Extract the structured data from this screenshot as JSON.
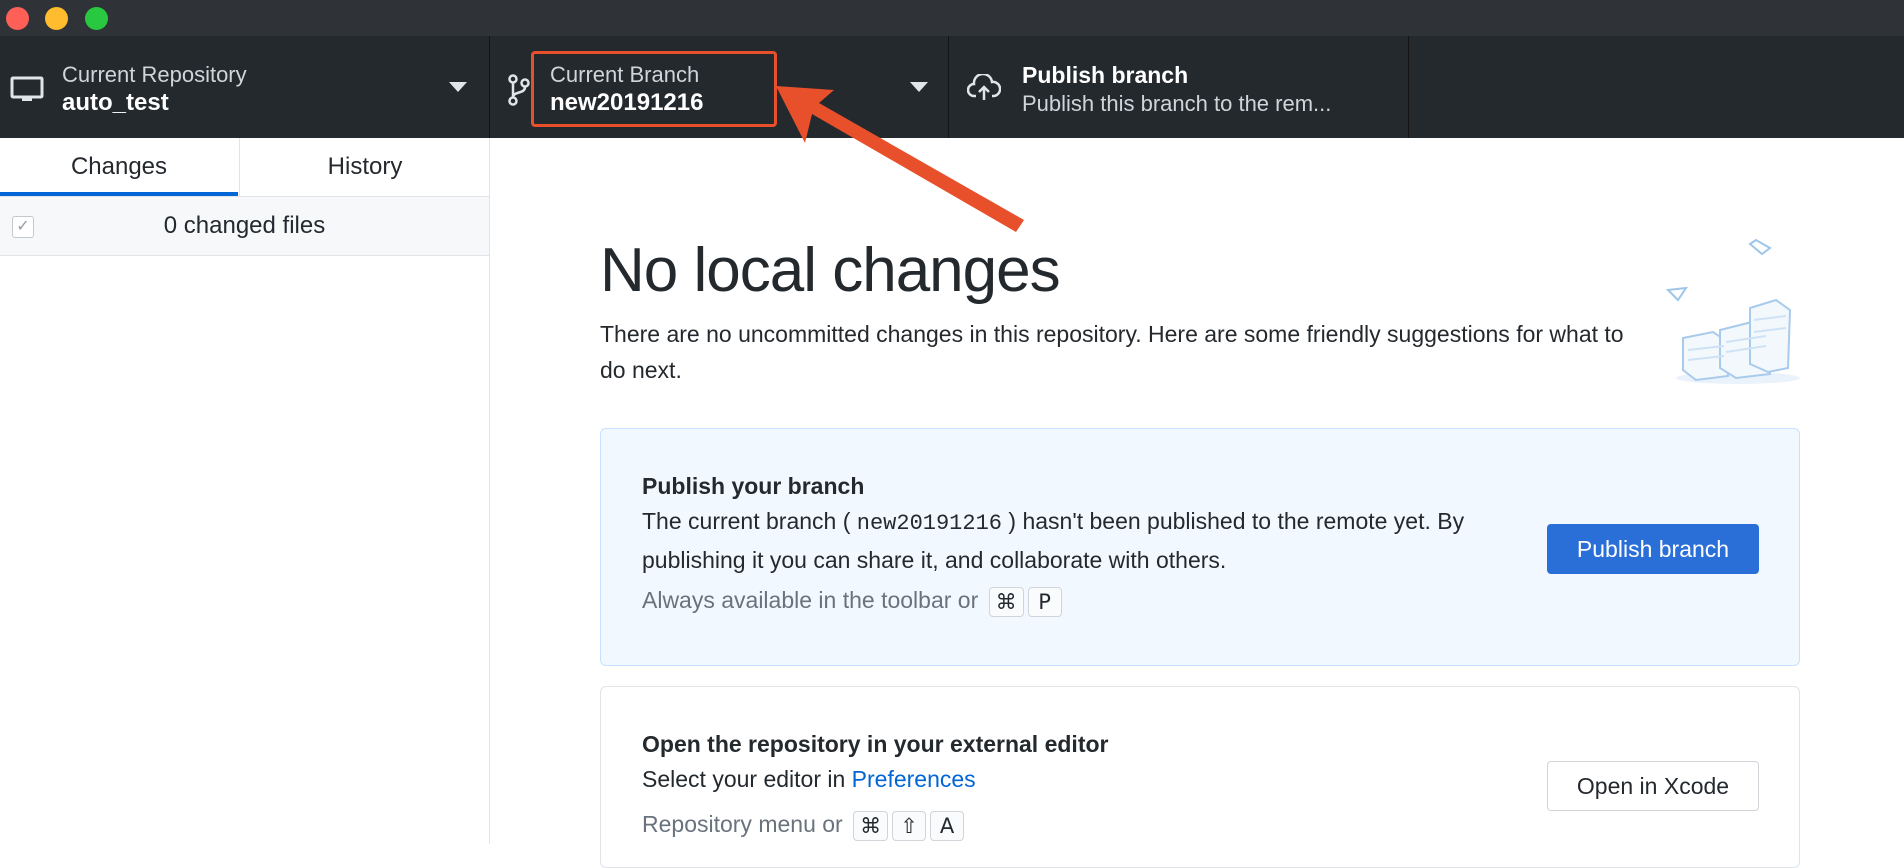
{
  "toolbar": {
    "repository": {
      "label": "Current Repository",
      "value": "auto_test"
    },
    "branch": {
      "label": "Current Branch",
      "value": "new20191216"
    },
    "publish": {
      "label": "Publish branch",
      "description": "Publish this branch to the rem..."
    }
  },
  "sidebar": {
    "tabs": [
      "Changes",
      "History"
    ],
    "changed_files": "0 changed files"
  },
  "main": {
    "heading": "No local changes",
    "subtext": "There are no uncommitted changes in this repository. Here are some friendly suggestions for what to do next.",
    "publish_card": {
      "title": "Publish your branch",
      "body_pre": "The current branch (",
      "branch": "new20191216",
      "body_post": ") hasn't been published to the remote yet. By publishing it you can share it, and collaborate with others.",
      "hint": "Always available in the toolbar or",
      "keys": [
        "⌘",
        "P"
      ],
      "button": "Publish branch"
    },
    "editor_card": {
      "title": "Open the repository in your external editor",
      "body_pre": "Select your editor in",
      "link": "Preferences",
      "hint": "Repository menu or",
      "keys": [
        "⌘",
        "⇧",
        "A"
      ],
      "button": "Open in Xcode"
    }
  },
  "annotation": {
    "color": "#e8502b"
  }
}
